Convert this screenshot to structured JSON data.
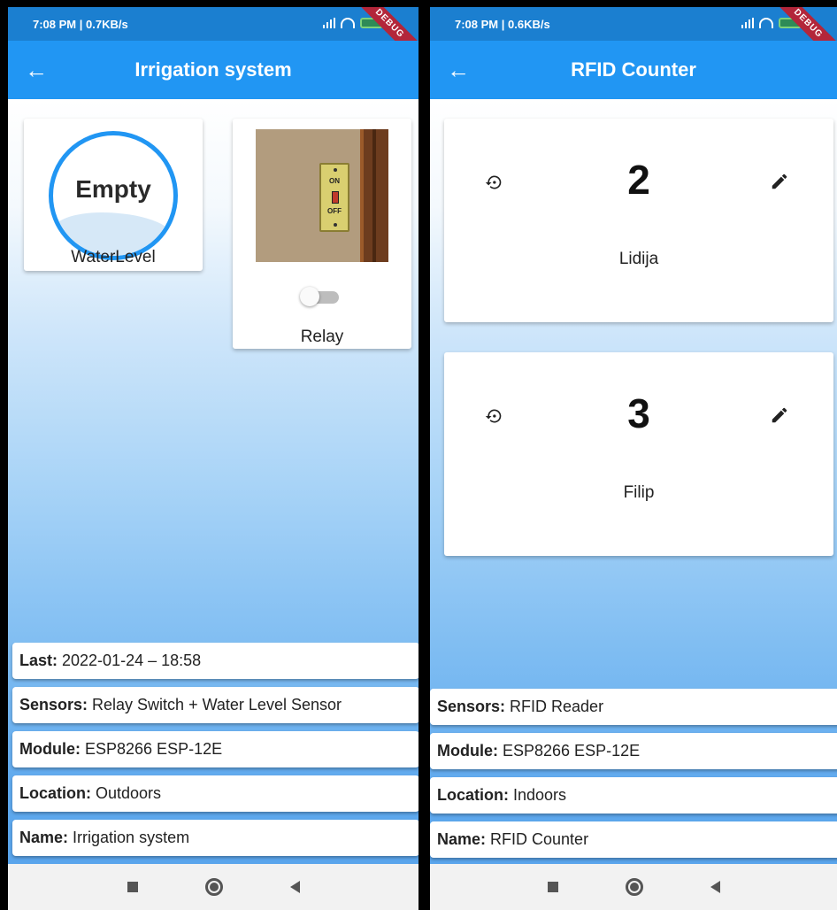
{
  "left_screen": {
    "status": {
      "time": "7:08 PM | 0.7KB/s",
      "debug_banner": "DEBUG"
    },
    "appbar": {
      "back_icon": "arrow-left-icon",
      "title": "Irrigation system"
    },
    "water_level": {
      "value_text": "Empty",
      "label": "WaterLevel",
      "fill_fraction": 0.36,
      "accent": "#2196f3"
    },
    "relay": {
      "label": "Relay",
      "on": false,
      "switch_on_text": "ON",
      "switch_off_text": "OFF"
    },
    "info": [
      {
        "key": "Last:",
        "value": "2022-01-24 – 18:58"
      },
      {
        "key": "Sensors:",
        "value": "Relay Switch + Water Level Sensor"
      },
      {
        "key": "Module:",
        "value": "ESP8266 ESP-12E"
      },
      {
        "key": "Location:",
        "value": "Outdoors"
      },
      {
        "key": "Name:",
        "value": "Irrigation system"
      }
    ]
  },
  "right_screen": {
    "status": {
      "time": "7:08 PM | 0.6KB/s",
      "debug_banner": "DEBUG"
    },
    "appbar": {
      "back_icon": "arrow-left-icon",
      "title": "RFID Counter"
    },
    "counters": [
      {
        "count": "2",
        "name": "Lidija",
        "reset_icon": "reset-icon",
        "edit_icon": "pencil-icon"
      },
      {
        "count": "3",
        "name": "Filip",
        "reset_icon": "reset-icon",
        "edit_icon": "pencil-icon"
      }
    ],
    "info": [
      {
        "key": "Sensors:",
        "value": "RFID Reader"
      },
      {
        "key": "Module:",
        "value": "ESP8266 ESP-12E"
      },
      {
        "key": "Location:",
        "value": "Indoors"
      },
      {
        "key": "Name:",
        "value": "RFID Counter"
      }
    ]
  },
  "navbar": {
    "icons": [
      "square-nav-icon",
      "home-circle-icon",
      "back-triangle-icon"
    ]
  },
  "colors": {
    "appbar": "#2196f3",
    "statusbar": "#1b7fd0",
    "debug": "#b3263a"
  }
}
